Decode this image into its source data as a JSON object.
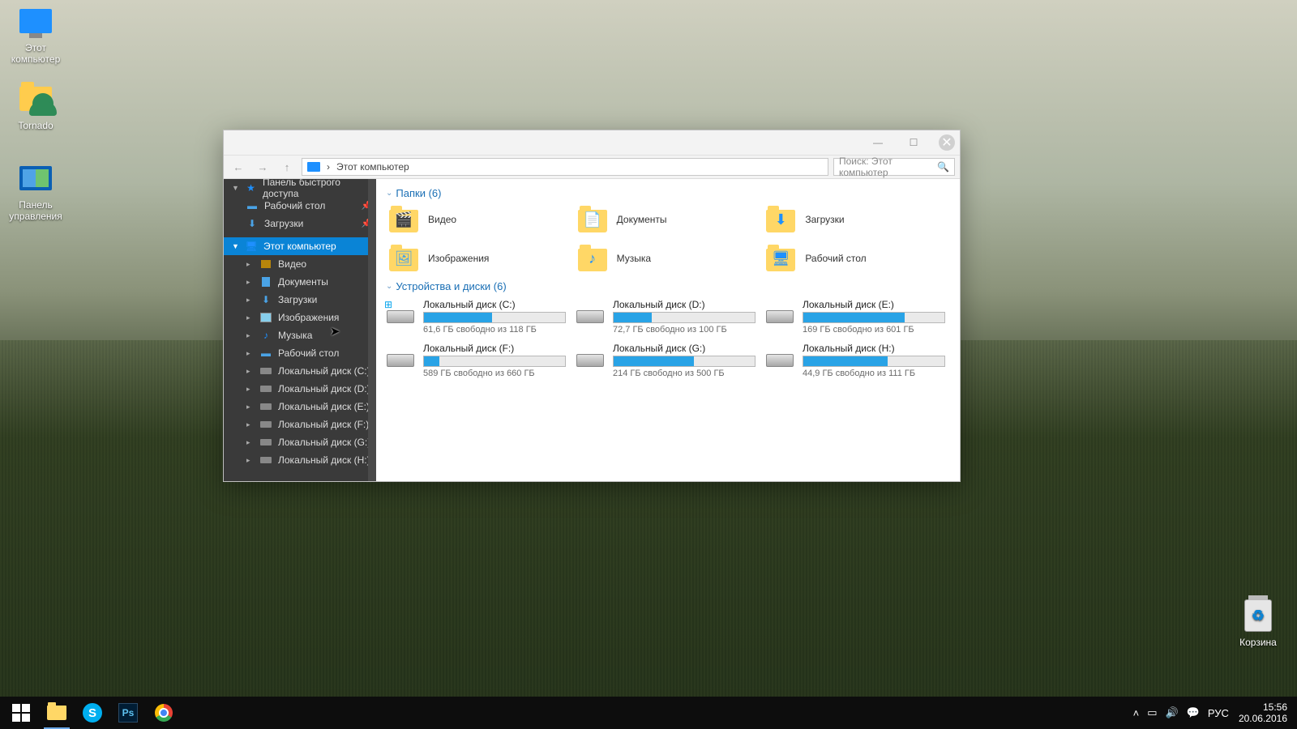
{
  "desktop": {
    "this_pc": "Этот\nкомпьютер",
    "tornado": "Tornado",
    "control_panel": "Панель\nуправления",
    "recycle_bin": "Корзина"
  },
  "explorer": {
    "address_label": "Этот компьютер",
    "address_sep": "›",
    "search_placeholder": "Поиск: Этот компьютер",
    "sidebar": {
      "quick_access": "Панель быстрого доступа",
      "desktop": "Рабочий стол",
      "downloads": "Загрузки",
      "this_pc": "Этот компьютер",
      "video": "Видео",
      "documents": "Документы",
      "downloads2": "Загрузки",
      "pictures": "Изображения",
      "music": "Музыка",
      "desktop2": "Рабочий стол",
      "drive_c": "Локальный диск (C:)",
      "drive_d": "Локальный диск (D:)",
      "drive_e": "Локальный диск (E:)",
      "drive_f": "Локальный диск (F:)",
      "drive_g": "Локальный диск (G:)",
      "drive_h": "Локальный диск (H:)"
    },
    "groups": {
      "folders": "Папки (6)",
      "drives": "Устройства и диски (6)"
    },
    "folders": {
      "video": "Видео",
      "documents": "Документы",
      "downloads": "Загрузки",
      "pictures": "Изображения",
      "music": "Музыка",
      "desktop": "Рабочий стол"
    },
    "drives": [
      {
        "name": "Локальный диск (C:)",
        "sub": "61,6 ГБ свободно из 118 ГБ",
        "used": 48
      },
      {
        "name": "Локальный диск (D:)",
        "sub": "72,7 ГБ свободно из 100 ГБ",
        "used": 27
      },
      {
        "name": "Локальный диск (E:)",
        "sub": "169 ГБ свободно из 601 ГБ",
        "used": 72
      },
      {
        "name": "Локальный диск (F:)",
        "sub": "589 ГБ свободно из 660 ГБ",
        "used": 11
      },
      {
        "name": "Локальный диск (G:)",
        "sub": "214 ГБ свободно из 500 ГБ",
        "used": 57
      },
      {
        "name": "Локальный диск (H:)",
        "sub": "44,9 ГБ свободно из 111 ГБ",
        "used": 60
      }
    ]
  },
  "taskbar": {
    "lang": "РУС",
    "time": "15:56",
    "date": "20.06.2016"
  }
}
